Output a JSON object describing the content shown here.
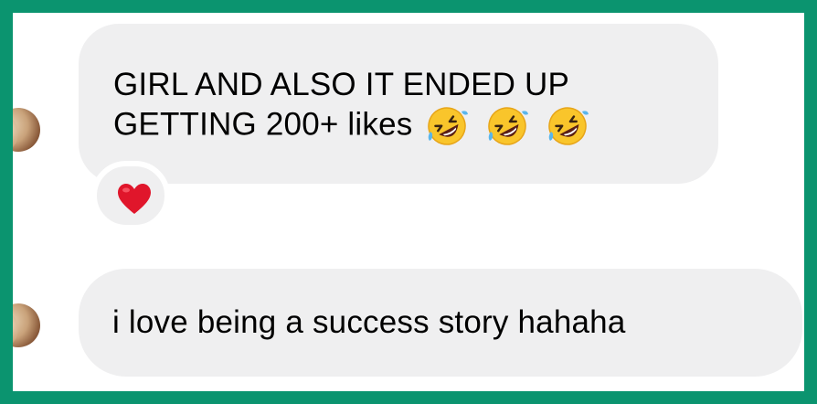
{
  "messages": [
    {
      "text": "GIRL AND ALSO IT ENDED UP GETTING 200+ likes",
      "emojis": [
        "rolling-on-floor-laughing-icon",
        "rolling-on-floor-laughing-icon",
        "rolling-on-floor-laughing-icon"
      ],
      "reaction": "heart-icon"
    },
    {
      "text": "i love being a success story hahaha"
    }
  ],
  "colors": {
    "frame": "#0b946f",
    "bubble": "#efeff0",
    "heart": "#e0162b"
  }
}
